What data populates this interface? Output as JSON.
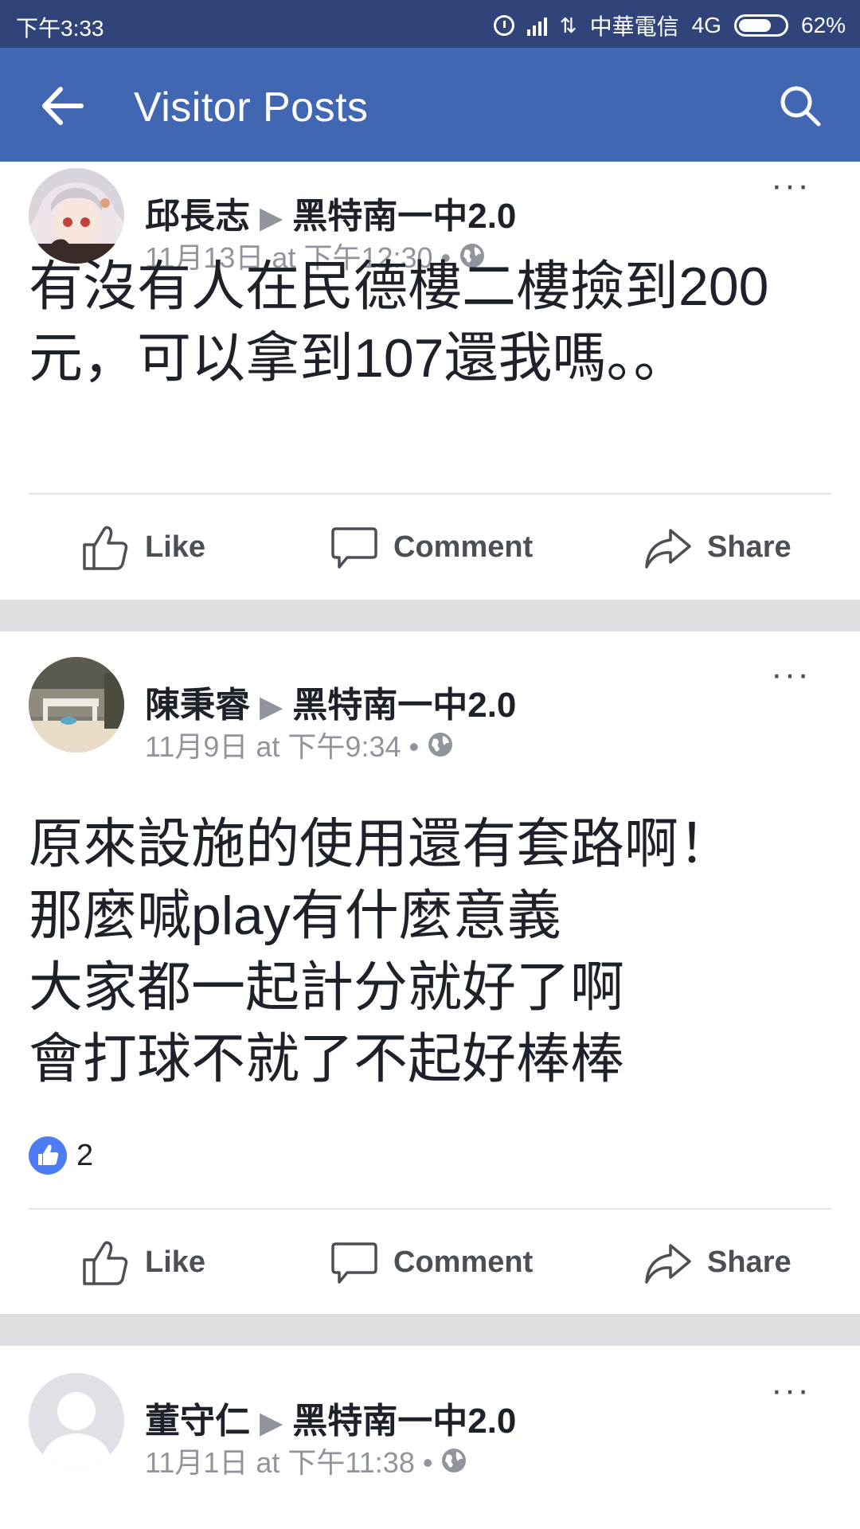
{
  "status_bar": {
    "time": "下午3:33",
    "carrier": "中華電信",
    "network": "4G",
    "battery": "62%"
  },
  "app_bar": {
    "title": "Visitor Posts",
    "back_icon": "back-arrow-icon",
    "search_icon": "search-icon",
    "background": "#4267b2"
  },
  "posts": [
    {
      "author": "邱長志",
      "page": "黑特南一中2.0",
      "timestamp": "11月13日 at 下午12:30 •",
      "text": "有沒有人在民德樓二樓撿到200\n元，可以拿到107還我嗎。。",
      "actions": {
        "like": "Like",
        "comment": "Comment",
        "share": "Share"
      }
    },
    {
      "author": "陳秉睿",
      "page": "黑特南一中2.0",
      "timestamp": "11月9日 at 下午9:34 •",
      "text": "原來設施的使用還有套路啊！\n那麼喊play有什麼意義\n大家都一起計分就好了啊\n會打球不就了不起好棒棒",
      "like_count": "2",
      "actions": {
        "like": "Like",
        "comment": "Comment",
        "share": "Share"
      }
    },
    {
      "author": "董守仁",
      "page": "黑特南一中2.0",
      "timestamp": "11月1日 at 下午11:38 •"
    }
  ]
}
